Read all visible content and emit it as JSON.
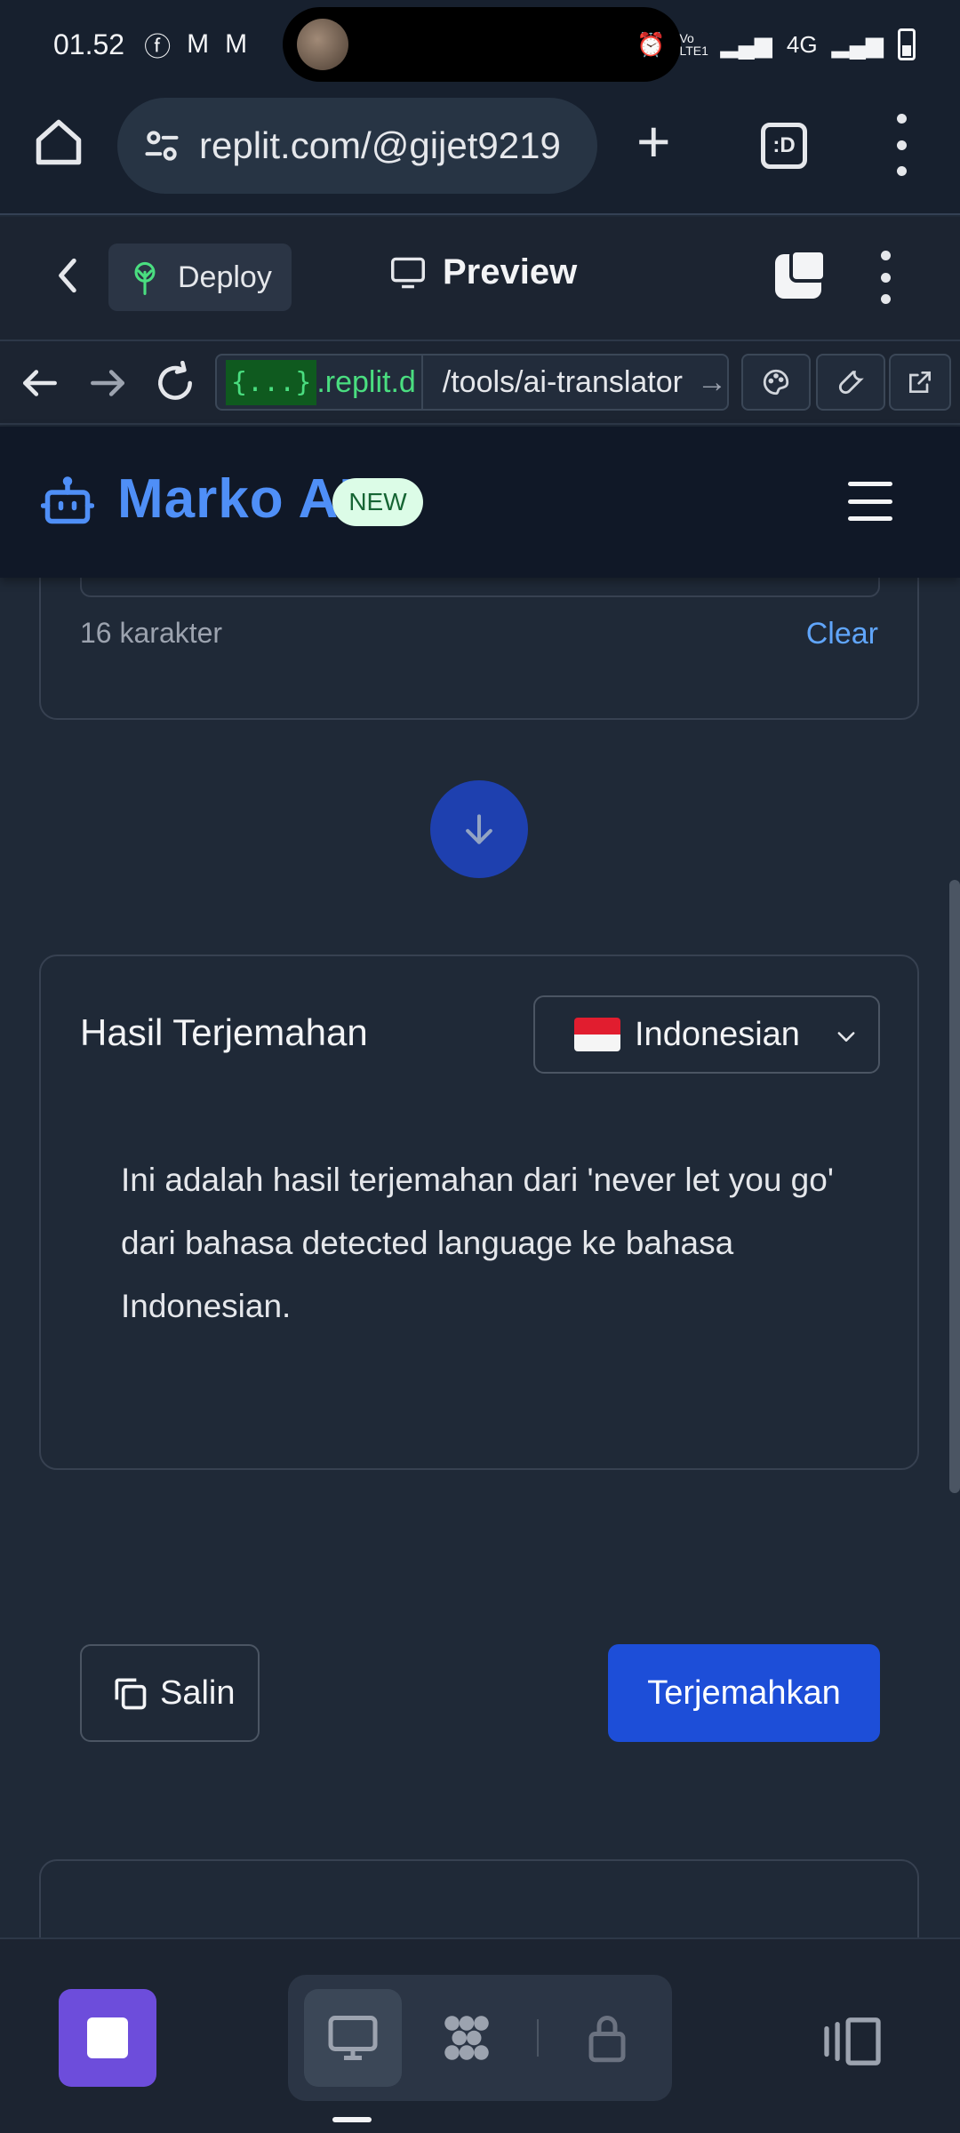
{
  "status_bar": {
    "time": "01.52",
    "right_text": "4G",
    "volte": "Vo LTE1"
  },
  "browser": {
    "url": "replit.com/@gijet9219",
    "tabs_label": ":D"
  },
  "replit": {
    "deploy_label": "Deploy",
    "preview_label": "Preview"
  },
  "devtools": {
    "repl_badge": "{...}",
    "host": ".replit.d",
    "path": "/tools/ai-translator"
  },
  "app": {
    "brand": "Marko AI",
    "badge": "NEW"
  },
  "input_card": {
    "char_count": "16 karakter",
    "clear_label": "Clear"
  },
  "result_card": {
    "title": "Hasil Terjemahan",
    "language": "Indonesian",
    "result_text": "Ini adalah hasil terjemahan dari 'never let you go' dari bahasa detected language ke bahasa Indonesian.",
    "copy_label": "Salin",
    "translate_label": "Terjemahkan"
  },
  "colors": {
    "accent": "#4f8ff7",
    "primary_button": "#1d4ed8",
    "stop_button": "#6d4ddb",
    "badge_bg": "#dcfce7"
  }
}
